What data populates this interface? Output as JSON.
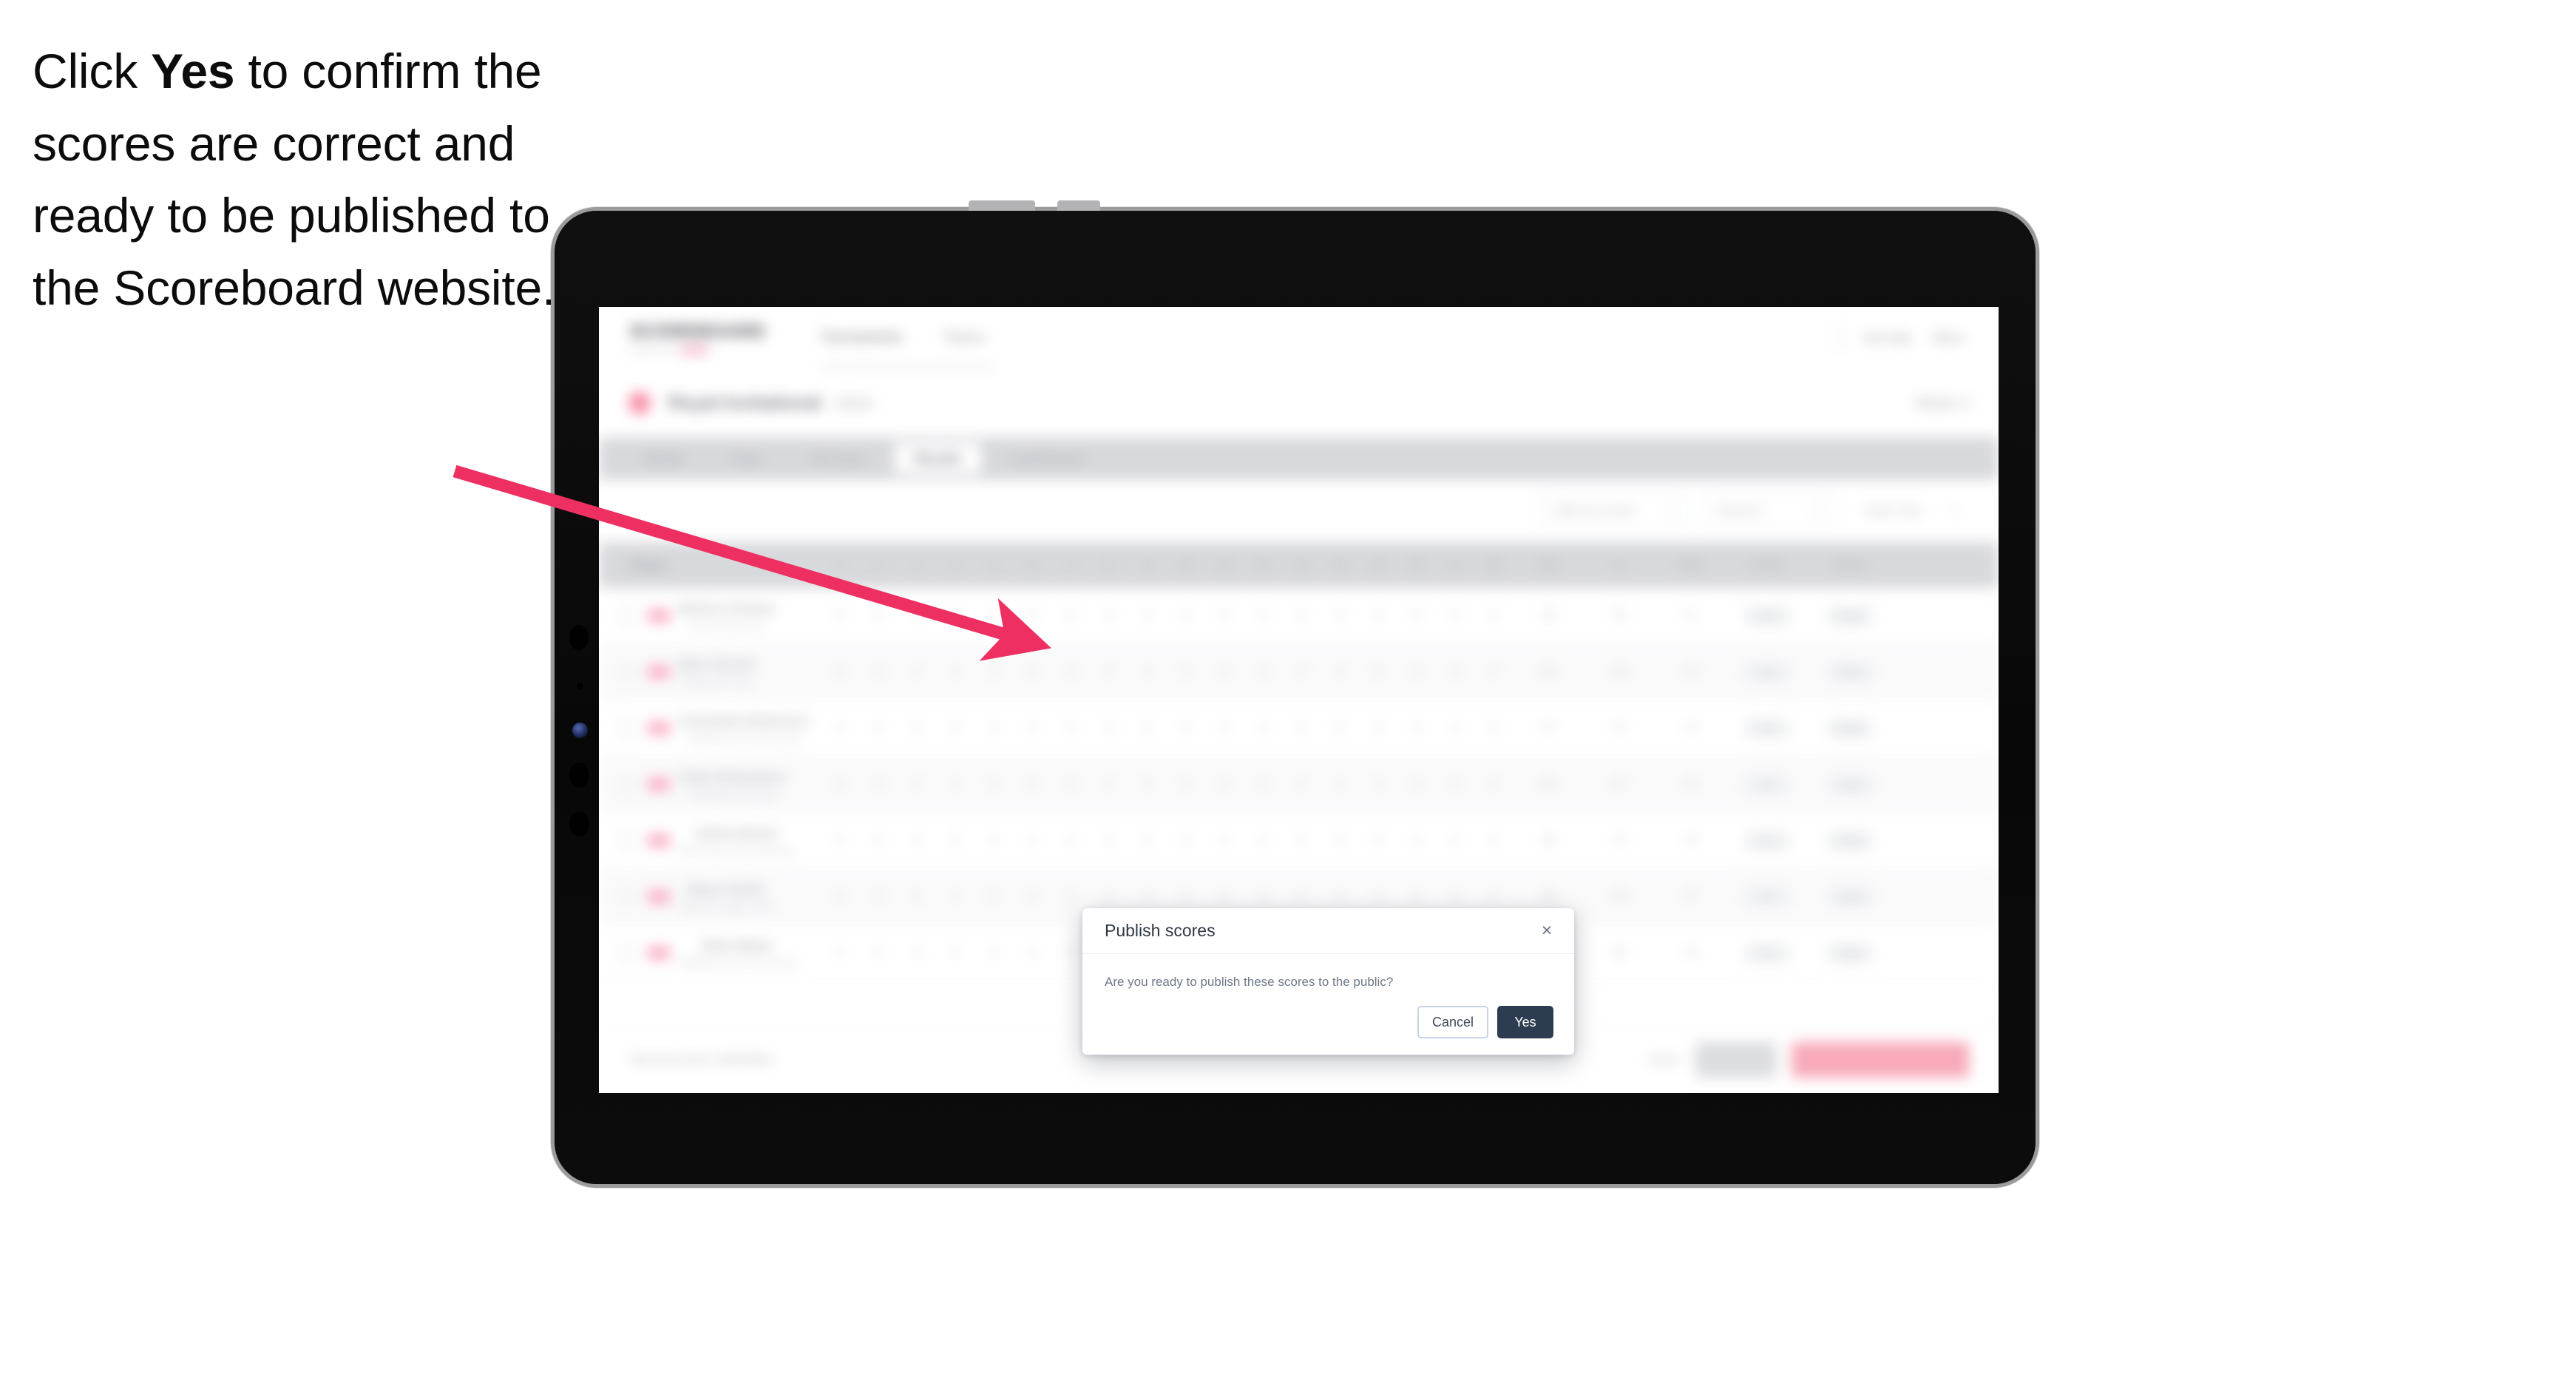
{
  "caption": {
    "part1": "Click ",
    "bold": "Yes",
    "part2": " to confirm the scores are correct and ready to be published to the Scoreboard website."
  },
  "annotation": {
    "arrow_color": "#ee2f62",
    "arrow_from": "615,637",
    "arrow_to": "1388,870"
  },
  "app": {
    "logo": {
      "main": "SCOREBOARD",
      "sub": "powered by"
    },
    "nav": [
      {
        "label": "Tournaments",
        "active": true
      },
      {
        "label": "Teams",
        "active": false
      }
    ],
    "nav_right": [
      {
        "label": "Get help"
      },
      {
        "label": "Menu"
      }
    ],
    "tournament": {
      "name": "Royal Invitational",
      "year": "2024",
      "right_meta": "Week 3"
    },
    "tabs": [
      {
        "label": "Details",
        "selected": false
      },
      {
        "label": "Draw",
        "selected": false
      },
      {
        "label": "Tee times",
        "selected": false
      },
      {
        "label": "Results",
        "selected": true
      },
      {
        "label": "Leaderboard",
        "selected": false
      }
    ],
    "filters": [
      {
        "label": "Filter by round",
        "caret": "▾"
      },
      {
        "label": "Round 1",
        "caret": "▾"
      },
      {
        "label": "Team only",
        "caret": "▾"
      }
    ],
    "table": {
      "player_header": "Player",
      "hole_headers": [
        "1",
        "2",
        "3",
        "4",
        "5",
        "6",
        "7",
        "8",
        "9",
        "10",
        "11",
        "12",
        "13",
        "14",
        "15",
        "16",
        "17",
        "18"
      ],
      "tail_headers": [
        "Out",
        "In",
        "Total",
        "Points",
        "Status"
      ],
      "rows": [
        {
          "name": "Melissa Thomas",
          "club": "Rivers Golf Club",
          "holes": [
            "4",
            "5",
            "4",
            "3",
            "4",
            "5",
            "4",
            "4",
            "3",
            "4",
            "5",
            "4",
            "3",
            "4",
            "4",
            "5",
            "4",
            "4"
          ],
          "out": "36",
          "in": "35",
          "total": "71",
          "points": "102",
          "status": "Final"
        },
        {
          "name": "Ellen Parnell",
          "club": "Sandy Hill Links",
          "holes": [
            "5",
            "4",
            "4",
            "4",
            "3",
            "5",
            "4",
            "5",
            "4",
            "4",
            "4",
            "4",
            "4",
            "3",
            "5",
            "4",
            "4",
            "4"
          ],
          "out": "38",
          "in": "36",
          "total": "74",
          "points": "100",
          "status": "Final"
        },
        {
          "name": "Cassandra Robertson",
          "club": "Westbrook Country Club",
          "holes": [
            "4",
            "4",
            "5",
            "3",
            "4",
            "4",
            "5",
            "4",
            "4",
            "5",
            "4",
            "3",
            "4",
            "5",
            "4",
            "4",
            "3",
            "5"
          ],
          "out": "37",
          "in": "37",
          "total": "74",
          "points": "98",
          "status": "Final"
        },
        {
          "name": "Claire Richardson",
          "club": "Northfield Golf Club",
          "holes": [
            "4",
            "5",
            "4",
            "4",
            "4",
            "5",
            "3",
            "4",
            "5",
            "4",
            "4",
            "5",
            "4",
            "4",
            "3",
            "4",
            "5",
            "4"
          ],
          "out": "38",
          "in": "37",
          "total": "75",
          "points": "96",
          "status": "Final"
        },
        {
          "name": "Helena Brand",
          "club": "Greenway Golf Academy",
          "holes": [
            "5",
            "4",
            "4",
            "5",
            "4",
            "4",
            "4",
            "3",
            "5",
            "4",
            "5",
            "4",
            "4",
            "4",
            "5",
            "3",
            "4",
            "4"
          ],
          "out": "38",
          "in": "37",
          "total": "75",
          "points": "94",
          "status": "Final"
        },
        {
          "name": "Maeve Smith",
          "club": "Hillcrest Ladies Club",
          "holes": [
            "4",
            "4",
            "5",
            "4",
            "5",
            "4",
            "4",
            "4",
            "4",
            "5",
            "4",
            "4",
            "5",
            "4",
            "4",
            "4",
            "4",
            "5"
          ],
          "out": "38",
          "in": "39",
          "total": "77",
          "points": "92",
          "status": "Final"
        },
        {
          "name": "Beth Walker",
          "club": "Oakfield Golf and Country",
          "holes": [
            "5",
            "5",
            "4",
            "4",
            "4",
            "5",
            "4",
            "4",
            "5",
            "4",
            "4",
            "5",
            "4",
            "5",
            "4",
            "4",
            "5",
            "4"
          ],
          "out": "40",
          "in": "39",
          "total": "79",
          "points": "90",
          "status": "Final"
        }
      ]
    },
    "footer": {
      "note": "Not all scores submitted",
      "link": "Reset",
      "save_label": "Save",
      "publish_label": "Publish all scores"
    }
  },
  "modal": {
    "title": "Publish scores",
    "close_icon": "×",
    "message": "Are you ready to publish these scores to the public?",
    "cancel_label": "Cancel",
    "confirm_label": "Yes",
    "confirm_color": "#2d3c50",
    "cancel_border_color": "#c8d4e6"
  }
}
